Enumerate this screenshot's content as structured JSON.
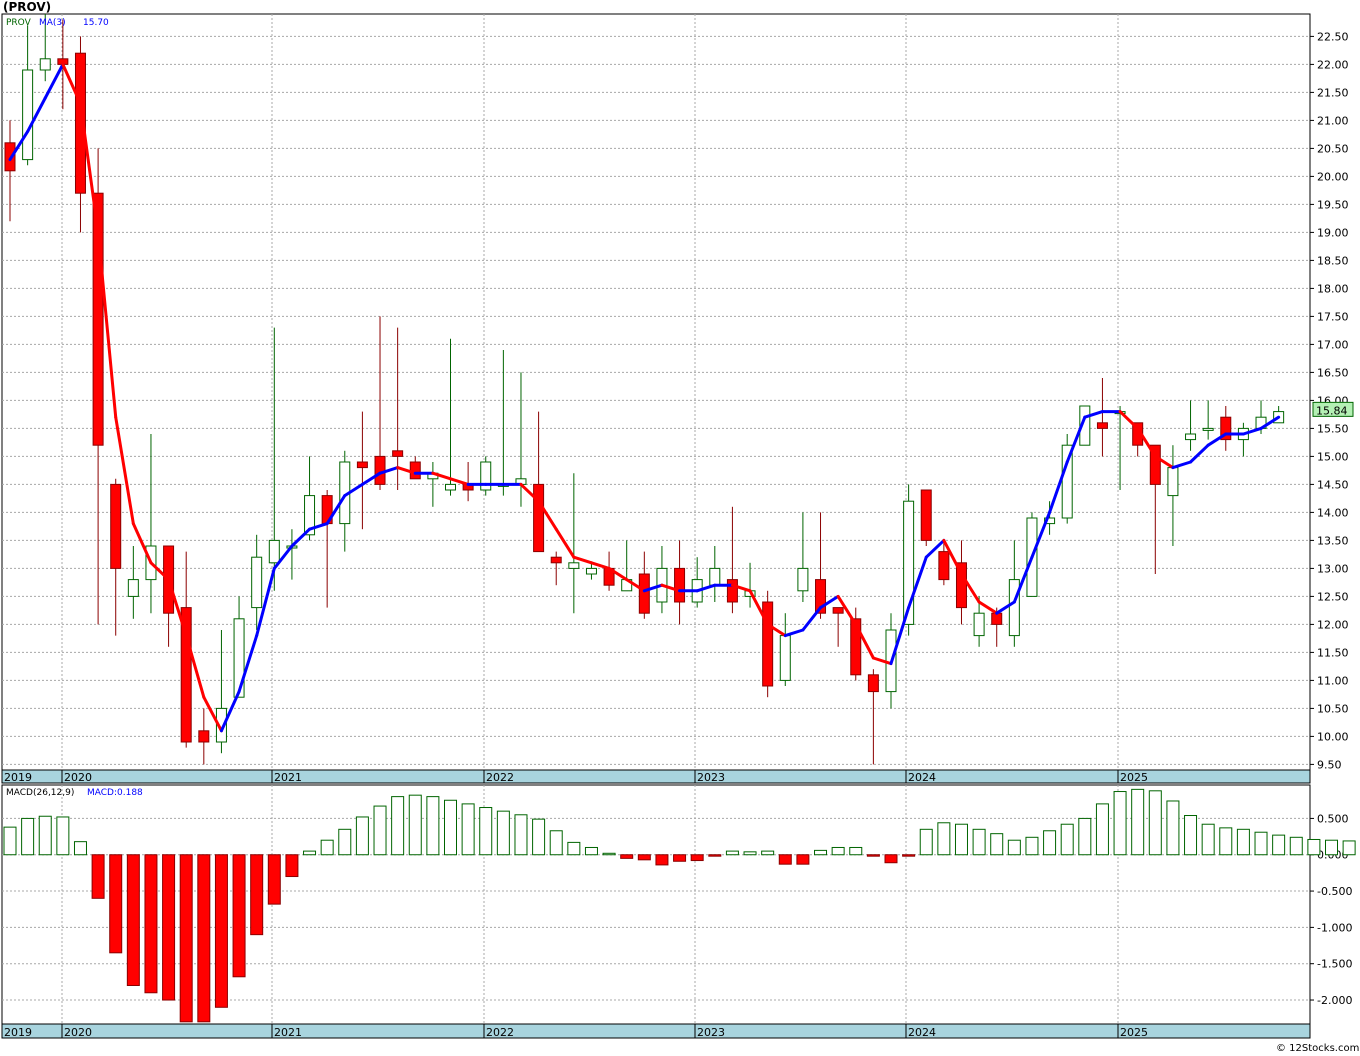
{
  "title": "(PROV)",
  "legend": {
    "symbol": "PROV",
    "ma_label": "MA(3)",
    "ma_value": "15.70",
    "macd_label": "MACD(26,12,9)",
    "macd_value": "MACD:0.188"
  },
  "last_price_label": "15.84",
  "copyright": "© 12Stocks.com",
  "colors": {
    "up": "#ffffff",
    "up_border": "#006400",
    "down": "#ff0000",
    "down_border": "#8b0000",
    "ma_up": "#0000ff",
    "ma_down": "#ff0000",
    "grid": "#a8a8a8",
    "axis_band": "#a8d4de",
    "price_badge": "#b4f0b4"
  },
  "chart_data": [
    {
      "type": "candlestick",
      "title": "(PROV)",
      "ylim": [
        9.4,
        22.9
      ],
      "y_ticks": [
        "9.50",
        "10.00",
        "10.50",
        "11.00",
        "11.50",
        "12.00",
        "12.50",
        "13.00",
        "13.50",
        "14.00",
        "14.50",
        "15.00",
        "15.50",
        "16.00",
        "16.50",
        "17.00",
        "17.50",
        "18.00",
        "18.50",
        "19.00",
        "19.50",
        "20.00",
        "20.50",
        "21.00",
        "21.50",
        "22.00",
        "22.50"
      ],
      "x_year_labels": [
        "2019",
        "2020",
        "2021",
        "2022",
        "2023",
        "2024",
        "2025"
      ],
      "candles": [
        {
          "o": 20.6,
          "h": 21.0,
          "l": 19.2,
          "c": 20.1
        },
        {
          "o": 20.3,
          "h": 22.7,
          "l": 20.2,
          "c": 21.9
        },
        {
          "o": 21.9,
          "h": 22.9,
          "l": 21.7,
          "c": 22.1
        },
        {
          "o": 22.1,
          "h": 22.8,
          "l": 21.2,
          "c": 22.0
        },
        {
          "o": 22.2,
          "h": 22.5,
          "l": 19.0,
          "c": 19.7
        },
        {
          "o": 19.7,
          "h": 20.5,
          "l": 12.0,
          "c": 15.2
        },
        {
          "o": 14.5,
          "h": 14.6,
          "l": 11.8,
          "c": 13.0
        },
        {
          "o": 12.5,
          "h": 13.4,
          "l": 12.1,
          "c": 12.8
        },
        {
          "o": 12.8,
          "h": 15.4,
          "l": 12.2,
          "c": 13.4
        },
        {
          "o": 13.4,
          "h": 13.4,
          "l": 11.6,
          "c": 12.2
        },
        {
          "o": 12.3,
          "h": 13.3,
          "l": 9.8,
          "c": 9.9
        },
        {
          "o": 10.1,
          "h": 10.5,
          "l": 9.5,
          "c": 9.9
        },
        {
          "o": 9.9,
          "h": 11.9,
          "l": 9.7,
          "c": 10.5
        },
        {
          "o": 10.7,
          "h": 12.5,
          "l": 10.7,
          "c": 12.1
        },
        {
          "o": 12.3,
          "h": 13.6,
          "l": 11.9,
          "c": 13.2
        },
        {
          "o": 13.1,
          "h": 17.3,
          "l": 12.6,
          "c": 13.5
        },
        {
          "o": 13.4,
          "h": 13.7,
          "l": 12.8,
          "c": 13.4
        },
        {
          "o": 13.6,
          "h": 15.0,
          "l": 13.5,
          "c": 14.3
        },
        {
          "o": 14.3,
          "h": 14.4,
          "l": 12.3,
          "c": 13.8
        },
        {
          "o": 13.8,
          "h": 15.1,
          "l": 13.3,
          "c": 14.9
        },
        {
          "o": 14.9,
          "h": 15.8,
          "l": 13.7,
          "c": 14.8
        },
        {
          "o": 15.0,
          "h": 17.5,
          "l": 14.4,
          "c": 14.5
        },
        {
          "o": 15.1,
          "h": 17.3,
          "l": 14.4,
          "c": 15.0
        },
        {
          "o": 14.9,
          "h": 15.0,
          "l": 14.6,
          "c": 14.6
        },
        {
          "o": 14.6,
          "h": 14.9,
          "l": 14.1,
          "c": 14.7
        },
        {
          "o": 14.4,
          "h": 17.1,
          "l": 14.3,
          "c": 14.5
        },
        {
          "o": 14.5,
          "h": 14.9,
          "l": 14.2,
          "c": 14.4
        },
        {
          "o": 14.4,
          "h": 15.0,
          "l": 14.3,
          "c": 14.9
        },
        {
          "o": 14.5,
          "h": 16.9,
          "l": 14.3,
          "c": 14.5
        },
        {
          "o": 14.5,
          "h": 16.5,
          "l": 14.1,
          "c": 14.6
        },
        {
          "o": 14.5,
          "h": 15.8,
          "l": 13.3,
          "c": 13.3
        },
        {
          "o": 13.2,
          "h": 13.3,
          "l": 12.7,
          "c": 13.1
        },
        {
          "o": 13.0,
          "h": 14.7,
          "l": 12.2,
          "c": 13.1
        },
        {
          "o": 12.9,
          "h": 13.1,
          "l": 12.8,
          "c": 13.0
        },
        {
          "o": 13.0,
          "h": 13.3,
          "l": 12.6,
          "c": 12.7
        },
        {
          "o": 12.6,
          "h": 13.5,
          "l": 12.6,
          "c": 12.8
        },
        {
          "o": 12.9,
          "h": 13.3,
          "l": 12.1,
          "c": 12.2
        },
        {
          "o": 12.4,
          "h": 13.4,
          "l": 12.2,
          "c": 13.0
        },
        {
          "o": 13.0,
          "h": 13.5,
          "l": 12.0,
          "c": 12.4
        },
        {
          "o": 12.4,
          "h": 13.2,
          "l": 12.3,
          "c": 12.8
        },
        {
          "o": 12.7,
          "h": 13.4,
          "l": 12.4,
          "c": 13.0
        },
        {
          "o": 12.8,
          "h": 14.1,
          "l": 12.2,
          "c": 12.4
        },
        {
          "o": 12.5,
          "h": 13.1,
          "l": 12.3,
          "c": 12.6
        },
        {
          "o": 12.4,
          "h": 12.6,
          "l": 10.7,
          "c": 10.9
        },
        {
          "o": 11.0,
          "h": 12.2,
          "l": 10.9,
          "c": 11.8
        },
        {
          "o": 12.6,
          "h": 14.0,
          "l": 12.4,
          "c": 13.0
        },
        {
          "o": 12.8,
          "h": 14.0,
          "l": 12.1,
          "c": 12.2
        },
        {
          "o": 12.3,
          "h": 12.3,
          "l": 11.6,
          "c": 12.2
        },
        {
          "o": 12.1,
          "h": 12.3,
          "l": 11.0,
          "c": 11.1
        },
        {
          "o": 11.1,
          "h": 11.2,
          "l": 9.5,
          "c": 10.8
        },
        {
          "o": 10.8,
          "h": 12.2,
          "l": 10.5,
          "c": 11.9
        },
        {
          "o": 12.0,
          "h": 14.5,
          "l": 11.8,
          "c": 14.2
        },
        {
          "o": 14.4,
          "h": 14.4,
          "l": 13.4,
          "c": 13.5
        },
        {
          "o": 13.3,
          "h": 13.5,
          "l": 12.7,
          "c": 12.8
        },
        {
          "o": 13.1,
          "h": 13.5,
          "l": 12.0,
          "c": 12.3
        },
        {
          "o": 11.8,
          "h": 12.5,
          "l": 11.6,
          "c": 12.2
        },
        {
          "o": 12.2,
          "h": 12.3,
          "l": 11.6,
          "c": 12.0
        },
        {
          "o": 11.8,
          "h": 13.5,
          "l": 11.6,
          "c": 12.8
        },
        {
          "o": 12.5,
          "h": 14.0,
          "l": 12.5,
          "c": 13.9
        },
        {
          "o": 13.8,
          "h": 14.2,
          "l": 13.6,
          "c": 13.9
        },
        {
          "o": 13.9,
          "h": 15.4,
          "l": 13.8,
          "c": 15.2
        },
        {
          "o": 15.2,
          "h": 15.9,
          "l": 15.2,
          "c": 15.9
        },
        {
          "o": 15.6,
          "h": 16.4,
          "l": 15.0,
          "c": 15.5
        },
        {
          "o": 15.8,
          "h": 15.9,
          "l": 14.4,
          "c": 15.8
        },
        {
          "o": 15.6,
          "h": 15.6,
          "l": 15.0,
          "c": 15.2
        },
        {
          "o": 15.2,
          "h": 15.2,
          "l": 12.9,
          "c": 14.5
        },
        {
          "o": 14.3,
          "h": 15.2,
          "l": 13.4,
          "c": 14.8
        },
        {
          "o": 15.3,
          "h": 16.0,
          "l": 15.1,
          "c": 15.4
        },
        {
          "o": 15.5,
          "h": 16.0,
          "l": 15.3,
          "c": 15.5
        },
        {
          "o": 15.7,
          "h": 15.9,
          "l": 15.1,
          "c": 15.3
        },
        {
          "o": 15.3,
          "h": 15.6,
          "l": 15.0,
          "c": 15.5
        },
        {
          "o": 15.5,
          "h": 16.0,
          "l": 15.4,
          "c": 15.7
        },
        {
          "o": 15.6,
          "h": 15.9,
          "l": 15.6,
          "c": 15.8
        }
      ],
      "ma3": [
        20.3,
        20.8,
        21.4,
        22.0,
        21.3,
        19.0,
        15.7,
        13.8,
        13.1,
        12.8,
        11.8,
        10.7,
        10.1,
        10.8,
        11.8,
        13.0,
        13.4,
        13.7,
        13.8,
        14.3,
        14.5,
        14.7,
        14.8,
        14.7,
        14.7,
        14.6,
        14.5,
        14.5,
        14.5,
        14.5,
        14.2,
        13.7,
        13.2,
        13.1,
        13.0,
        12.8,
        12.6,
        12.7,
        12.6,
        12.6,
        12.7,
        12.7,
        12.6,
        12.0,
        11.8,
        11.9,
        12.3,
        12.5,
        12.0,
        11.4,
        11.3,
        12.3,
        13.2,
        13.5,
        12.9,
        12.4,
        12.2,
        12.4,
        13.2,
        14.0,
        14.9,
        15.7,
        15.8,
        15.8,
        15.5,
        15.0,
        14.8,
        14.9,
        15.2,
        15.4,
        15.4,
        15.5,
        15.7
      ]
    },
    {
      "type": "bar",
      "title": "MACD(26,12,9)",
      "ylim": [
        -2.33,
        0.96
      ],
      "y_ticks": [
        "0.500",
        "0.000",
        "-0.500",
        "-1.000",
        "-1.500",
        "-2.000"
      ],
      "values": [
        0.38,
        0.5,
        0.53,
        0.52,
        0.18,
        -0.6,
        -1.35,
        -1.8,
        -1.9,
        -2.0,
        -2.3,
        -2.3,
        -2.1,
        -1.68,
        -1.1,
        -0.68,
        -0.3,
        0.05,
        0.2,
        0.35,
        0.52,
        0.67,
        0.8,
        0.82,
        0.8,
        0.75,
        0.7,
        0.65,
        0.6,
        0.55,
        0.49,
        0.33,
        0.17,
        0.1,
        0.02,
        -0.05,
        -0.07,
        -0.14,
        -0.09,
        -0.08,
        -0.02,
        0.05,
        0.04,
        0.05,
        -0.13,
        -0.13,
        0.06,
        0.1,
        0.1,
        -0.02,
        -0.11,
        -0.02,
        0.35,
        0.44,
        0.42,
        0.35,
        0.29,
        0.2,
        0.24,
        0.33,
        0.42,
        0.5,
        0.7,
        0.87,
        0.9,
        0.88,
        0.74,
        0.54,
        0.42,
        0.37,
        0.35,
        0.31,
        0.27,
        0.24,
        0.21,
        0.2,
        0.19
      ]
    }
  ]
}
